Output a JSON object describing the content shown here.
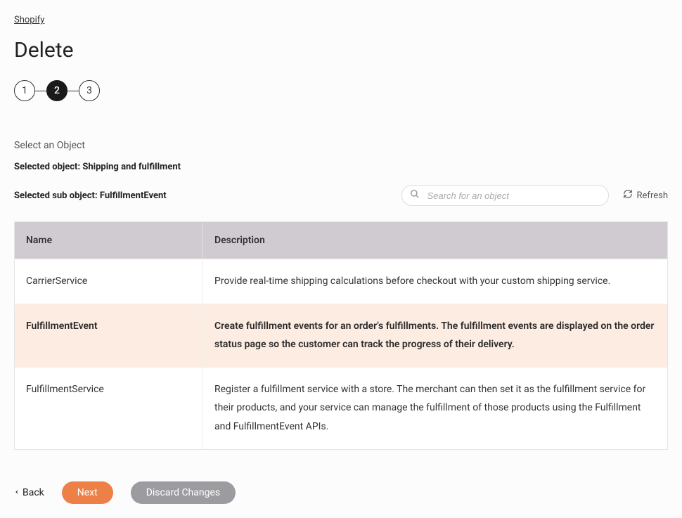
{
  "breadcrumb": "Shopify",
  "title": "Delete",
  "stepper": {
    "steps": [
      "1",
      "2",
      "3"
    ],
    "active": 1
  },
  "section_label": "Select an Object",
  "selected_object_line": "Selected object: Shipping and fulfillment",
  "selected_sub_line": "Selected sub object: FulfillmentEvent",
  "search": {
    "placeholder": "Search for an object"
  },
  "refresh_label": "Refresh",
  "table": {
    "headers": {
      "name": "Name",
      "description": "Description"
    },
    "rows": [
      {
        "name": "CarrierService",
        "description": "Provide real-time shipping calculations before checkout with your custom shipping service.",
        "selected": false
      },
      {
        "name": "FulfillmentEvent",
        "description": "Create fulfillment events for an order's fulfillments. The fulfillment events are displayed on the order status page so the customer can track the progress of their delivery.",
        "selected": true
      },
      {
        "name": "FulfillmentService",
        "description": "Register a fulfillment service with a store. The merchant can then set it as the fulfillment service for their products, and your service can manage the fulfillment of those products using the Fulfillment and FulfillmentEvent APIs.",
        "selected": false
      }
    ]
  },
  "footer": {
    "back": "Back",
    "next": "Next",
    "discard": "Discard Changes"
  }
}
